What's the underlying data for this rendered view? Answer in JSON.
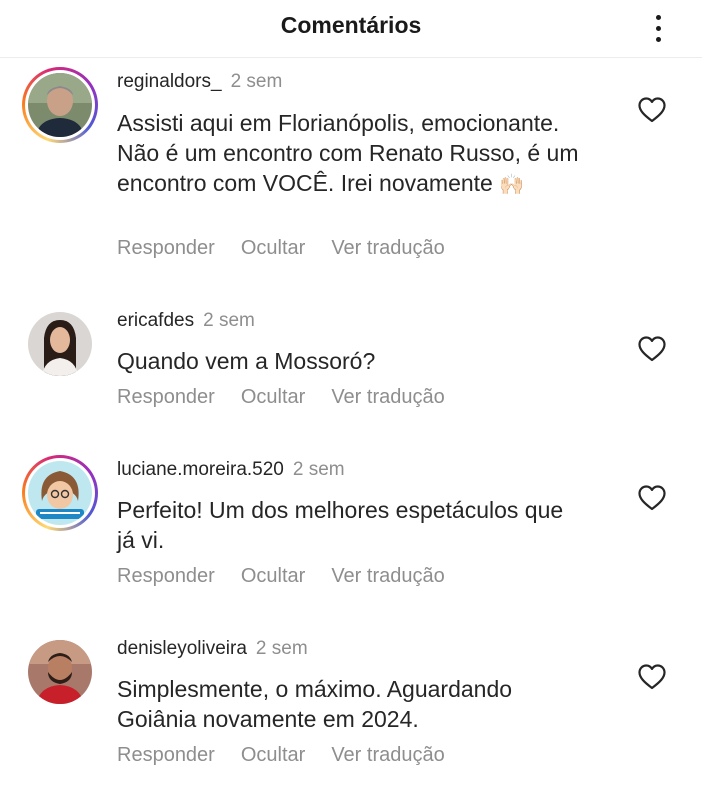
{
  "header": {
    "title": "Comentários",
    "more_icon": "more-vertical-icon"
  },
  "comments": [
    {
      "username": "reginaldors_",
      "time": "2 sem",
      "text": "Assisti aqui em Florianópolis, emocionante. Não é um encontro com Renato Russo, é um encontro com VOCÊ. Irei novamente",
      "emoji": "🙌🏻",
      "has_story": true,
      "actions": {
        "reply": "Responder",
        "hide": "Ocultar",
        "translate": "Ver tradução"
      }
    },
    {
      "username": "ericafdes",
      "time": "2 sem",
      "text": "Quando vem a Mossoró?",
      "has_story": false,
      "actions": {
        "reply": "Responder",
        "hide": "Ocultar",
        "translate": "Ver tradução"
      }
    },
    {
      "username": "luciane.moreira.520",
      "time": "2 sem",
      "text": "Perfeito! Um dos melhores espetáculos que já vi.",
      "has_story": true,
      "actions": {
        "reply": "Responder",
        "hide": "Ocultar",
        "translate": "Ver tradução"
      }
    },
    {
      "username": "denisleyoliveira",
      "time": "2 sem",
      "text": "Simplesmente, o máximo. Aguardando Goiânia novamente em 2024.",
      "has_story": false,
      "actions": {
        "reply": "Responder",
        "hide": "Ocultar",
        "translate": "Ver tradução"
      }
    }
  ],
  "colors": {
    "text": "#262626",
    "secondary": "#8e8e8e",
    "divider": "#ececec"
  }
}
